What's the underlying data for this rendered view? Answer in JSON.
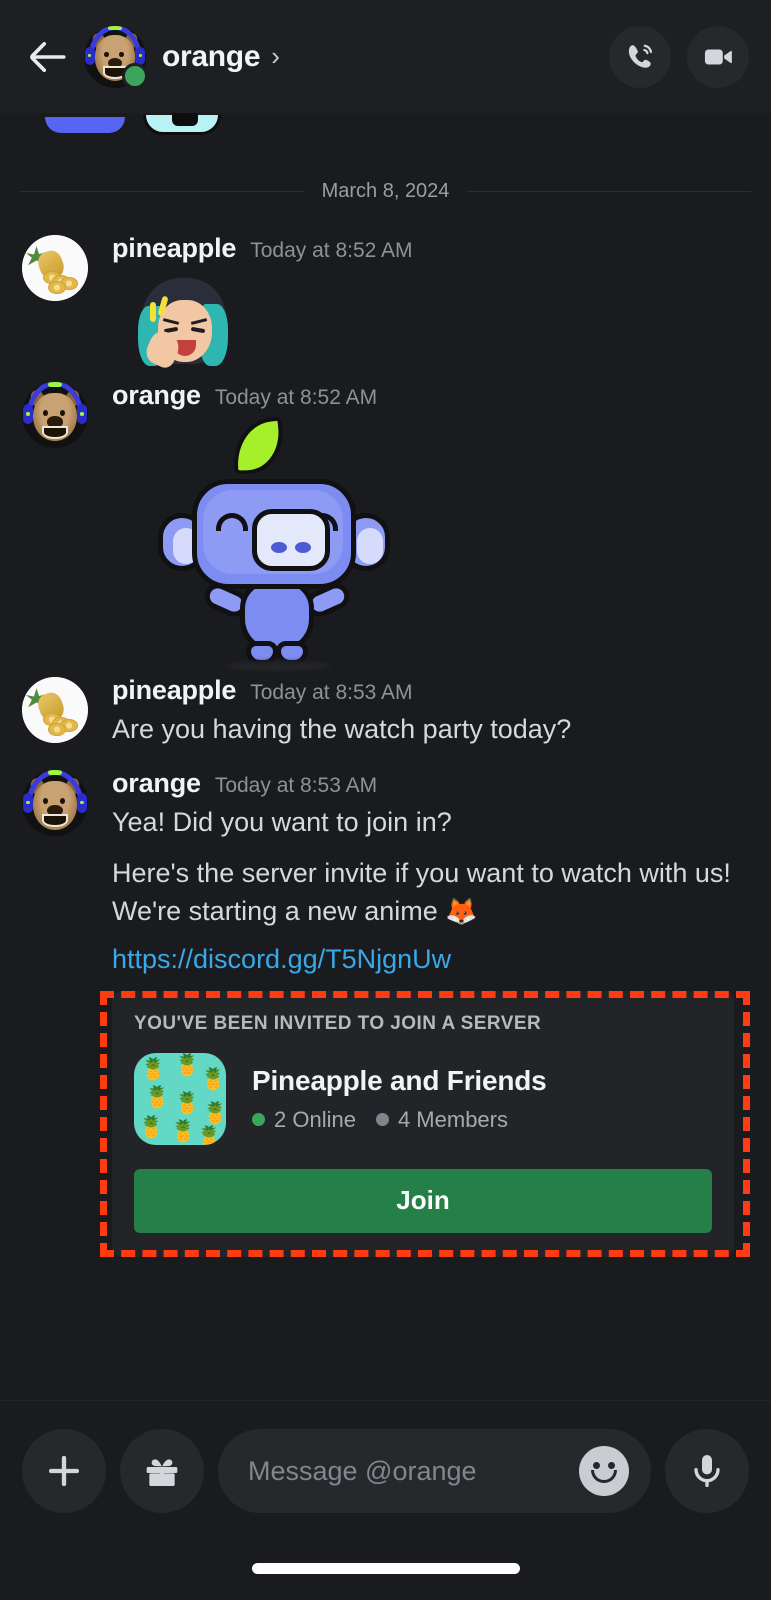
{
  "header": {
    "back_icon": "arrow-left-icon",
    "username": "orange",
    "chevron": "›",
    "status": "online",
    "call_icon": "phone-call-icon",
    "video_icon": "video-camera-icon"
  },
  "chat": {
    "date_divider": "March 8, 2024",
    "messages": [
      {
        "author": "pineapple",
        "timestamp": "Today at 8:52 AM",
        "avatar": "pineapple-plate-avatar",
        "type": "sticker",
        "sticker_name": "anime-girl-sticker",
        "text": ""
      },
      {
        "author": "orange",
        "timestamp": "Today at 8:52 AM",
        "avatar": "doge-headphones-avatar",
        "type": "sticker",
        "sticker_name": "wumpus-sprout-sticker",
        "text": ""
      },
      {
        "author": "pineapple",
        "timestamp": "Today at 8:53 AM",
        "avatar": "pineapple-plate-avatar",
        "type": "text",
        "text": "Are you having the watch party today?"
      },
      {
        "author": "orange",
        "timestamp": "Today at 8:53 AM",
        "avatar": "doge-headphones-avatar",
        "type": "text",
        "text": "Yea! Did you want to join in?",
        "line2": "Here's the server invite if you want to watch with us! We're starting a new anime",
        "emoji": "🦊",
        "link": "https://discord.gg/T5NjgnUw"
      }
    ]
  },
  "invite": {
    "title": "YOU'VE BEEN INVITED TO JOIN A SERVER",
    "server_name": "Pineapple and Friends",
    "online_count": "2 Online",
    "member_count": "4 Members",
    "join_label": "Join",
    "server_icon": "pineapple-pattern-icon",
    "accent_green": "#248046",
    "online_green": "#3ba55d",
    "highlight_color": "#ff3b14"
  },
  "composer": {
    "add_icon": "plus-icon",
    "gift_icon": "gift-icon",
    "placeholder": "Message @orange",
    "emoji_icon": "smiley-face-icon",
    "mic_icon": "microphone-icon"
  }
}
